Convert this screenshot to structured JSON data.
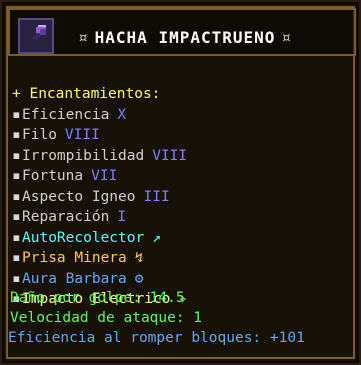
{
  "item": {
    "icon": "purple-axe-icon",
    "title": "HACHA IMPACTRUENO",
    "title_deco_left": "¤",
    "title_deco_right": "¤"
  },
  "enchantments": {
    "header": "+ Encantamientos:",
    "bullet": "▪",
    "items": [
      {
        "name": "Eficiencia",
        "level": "X",
        "name_color": "#cfcfcf",
        "level_color": "#7f7fff"
      },
      {
        "name": "Filo",
        "level": "VIII",
        "name_color": "#cfcfcf",
        "level_color": "#7f7fff"
      },
      {
        "name": "Irrompibilidad",
        "level": "VIII",
        "name_color": "#cfcfcf",
        "level_color": "#7f7fff"
      },
      {
        "name": "Fortuna",
        "level": "VII",
        "name_color": "#cfcfcf",
        "level_color": "#7f7fff"
      },
      {
        "name": "Aspecto Igneo",
        "level": "III",
        "name_color": "#cfcfcf",
        "level_color": "#7f7fff"
      },
      {
        "name": "Reparación",
        "level": "I",
        "name_color": "#cfcfcf",
        "level_color": "#7f7fff"
      },
      {
        "name": "AutoRecolector",
        "level": "↗",
        "name_color": "#55ffff",
        "level_color": "#55ffff"
      },
      {
        "name": "Prisa Minera",
        "level": "↯",
        "name_color": "#ffcc44",
        "level_color": "#ffcc44"
      },
      {
        "name": "Aura Barbara",
        "level": "⚙",
        "name_color": "#5fa8ff",
        "level_color": "#5fa8ff"
      },
      {
        "name": "Impacto Electrico",
        "level": "✧",
        "name_color": "#ffff88",
        "level_color": "#ffff88"
      }
    ]
  },
  "stats": {
    "damage": "Daño por golpe: 14.5",
    "speed": "Velocidad de ataque: 1",
    "efficiency": "Eficiencia al romper bloques: +101"
  },
  "colors": {
    "border": "#7a5c2e",
    "header": "#ffff55",
    "stat_green": "#55ff55",
    "efficiency_blue": "#5fa8ff"
  }
}
